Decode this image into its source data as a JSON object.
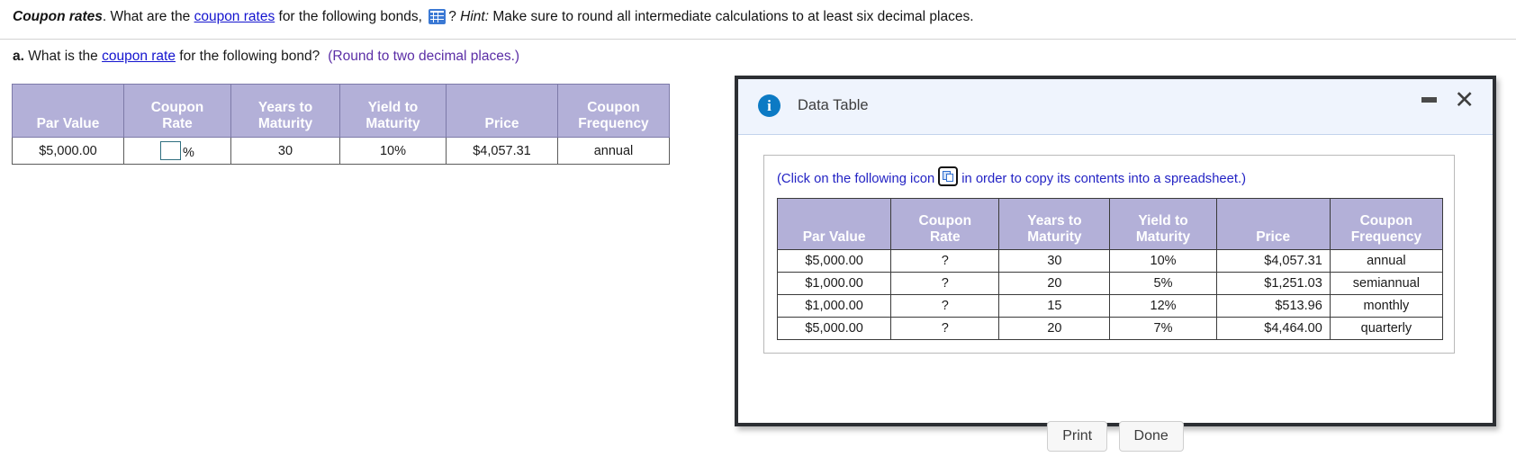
{
  "question": {
    "title": "Coupon rates",
    "text_1": ". What are the ",
    "link_1": "coupon rates",
    "text_2": " for the following bonds, ",
    "icon": "spreadsheet-grid-icon",
    "text_3": "? ",
    "hint_label": "Hint:",
    "text_4": " Make sure to round all intermediate calculations to at least six decimal places."
  },
  "part_a": {
    "letter": "a.",
    "text_1": " What is the ",
    "link": "coupon rate",
    "text_2": " for the following bond?",
    "round_note": "(Round to two decimal places.)"
  },
  "main_table": {
    "headers": [
      "Par Value",
      "Coupon Rate",
      "Years to Maturity",
      "Yield to Maturity",
      "Price",
      "Coupon Frequency"
    ],
    "header_lines": [
      [
        "",
        "Par Value"
      ],
      [
        "Coupon",
        "Rate"
      ],
      [
        "Years to",
        "Maturity"
      ],
      [
        "Yield to",
        "Maturity"
      ],
      [
        "",
        "Price"
      ],
      [
        "Coupon",
        "Frequency"
      ]
    ],
    "row": {
      "par_value": "$5,000.00",
      "coupon_rate_input_value": "",
      "coupon_rate_suffix": "%",
      "years_to_maturity": "30",
      "yield_to_maturity": "10%",
      "price": "$4,057.31",
      "coupon_frequency": "annual"
    }
  },
  "dialog": {
    "title": "Data Table",
    "info_icon": "info-icon",
    "minimize_label": "minimize-icon",
    "close_label": "✕",
    "copy_line_before": "(Click on the following icon",
    "copy_icon": "copy-to-spreadsheet-icon",
    "copy_line_after": "in order to copy its contents into a spreadsheet.)",
    "buttons": {
      "print": "Print",
      "done": "Done"
    },
    "table": {
      "header_lines": [
        [
          "",
          "Par Value"
        ],
        [
          "Coupon",
          "Rate"
        ],
        [
          "Years to",
          "Maturity"
        ],
        [
          "Yield to",
          "Maturity"
        ],
        [
          "",
          "Price"
        ],
        [
          "Coupon",
          "Frequency"
        ]
      ],
      "rows": [
        {
          "par_value": "$5,000.00",
          "coupon_rate": "?",
          "years": "30",
          "ytm": "10%",
          "price": "$4,057.31",
          "frequency": "annual"
        },
        {
          "par_value": "$1,000.00",
          "coupon_rate": "?",
          "years": "20",
          "ytm": "5%",
          "price": "$1,251.03",
          "frequency": "semiannual"
        },
        {
          "par_value": "$1,000.00",
          "coupon_rate": "?",
          "years": "15",
          "ytm": "12%",
          "price": "$513.96",
          "frequency": "monthly"
        },
        {
          "par_value": "$5,000.00",
          "coupon_rate": "?",
          "years": "20",
          "ytm": "7%",
          "price": "$4,464.00",
          "frequency": "quarterly"
        }
      ]
    }
  },
  "colors": {
    "table_header_bg": "#b3b0d8",
    "link": "#1414cf",
    "round_note": "#5b2ea6",
    "dialog_titlebar": "#eff4fd",
    "info_blue": "#0c7ac4",
    "copy_text": "#2323c4",
    "input_border": "#2f6f80"
  }
}
